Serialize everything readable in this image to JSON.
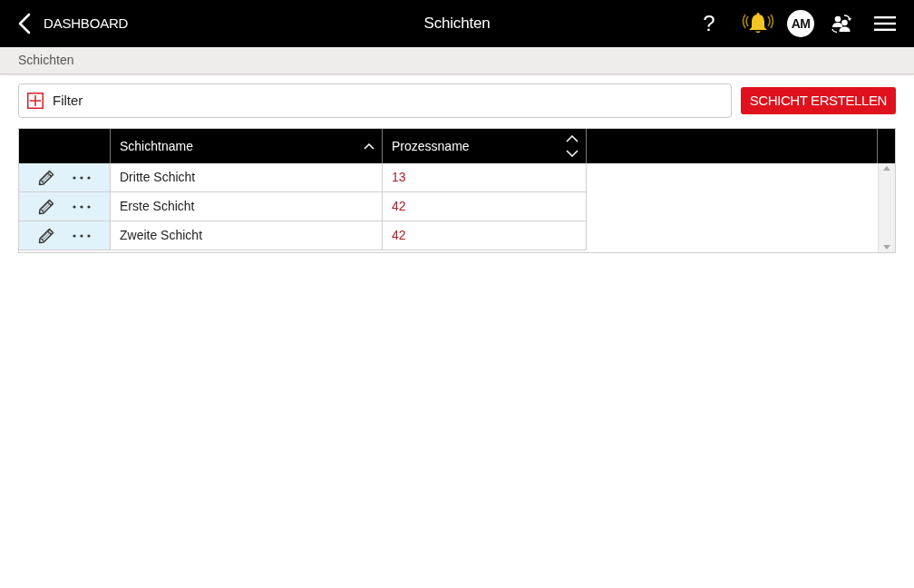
{
  "header": {
    "back_label": "DASHBOARD",
    "title": "Schichten",
    "help": "?",
    "avatar": "AM"
  },
  "breadcrumb": [
    "Schichten"
  ],
  "filter": {
    "label": "Filter",
    "expanded": false
  },
  "create_button": "SCHICHT ERSTELLEN",
  "table": {
    "columns": [
      {
        "label": "Schichtname",
        "sorted": true
      },
      {
        "label": "Prozessname",
        "sorted": false
      }
    ],
    "rows": [
      {
        "cells": [
          "Dritte Schicht",
          "13"
        ]
      },
      {
        "cells": [
          "Erste Schicht",
          "42"
        ]
      },
      {
        "cells": [
          "Zweite Schicht",
          "42"
        ]
      }
    ]
  }
}
